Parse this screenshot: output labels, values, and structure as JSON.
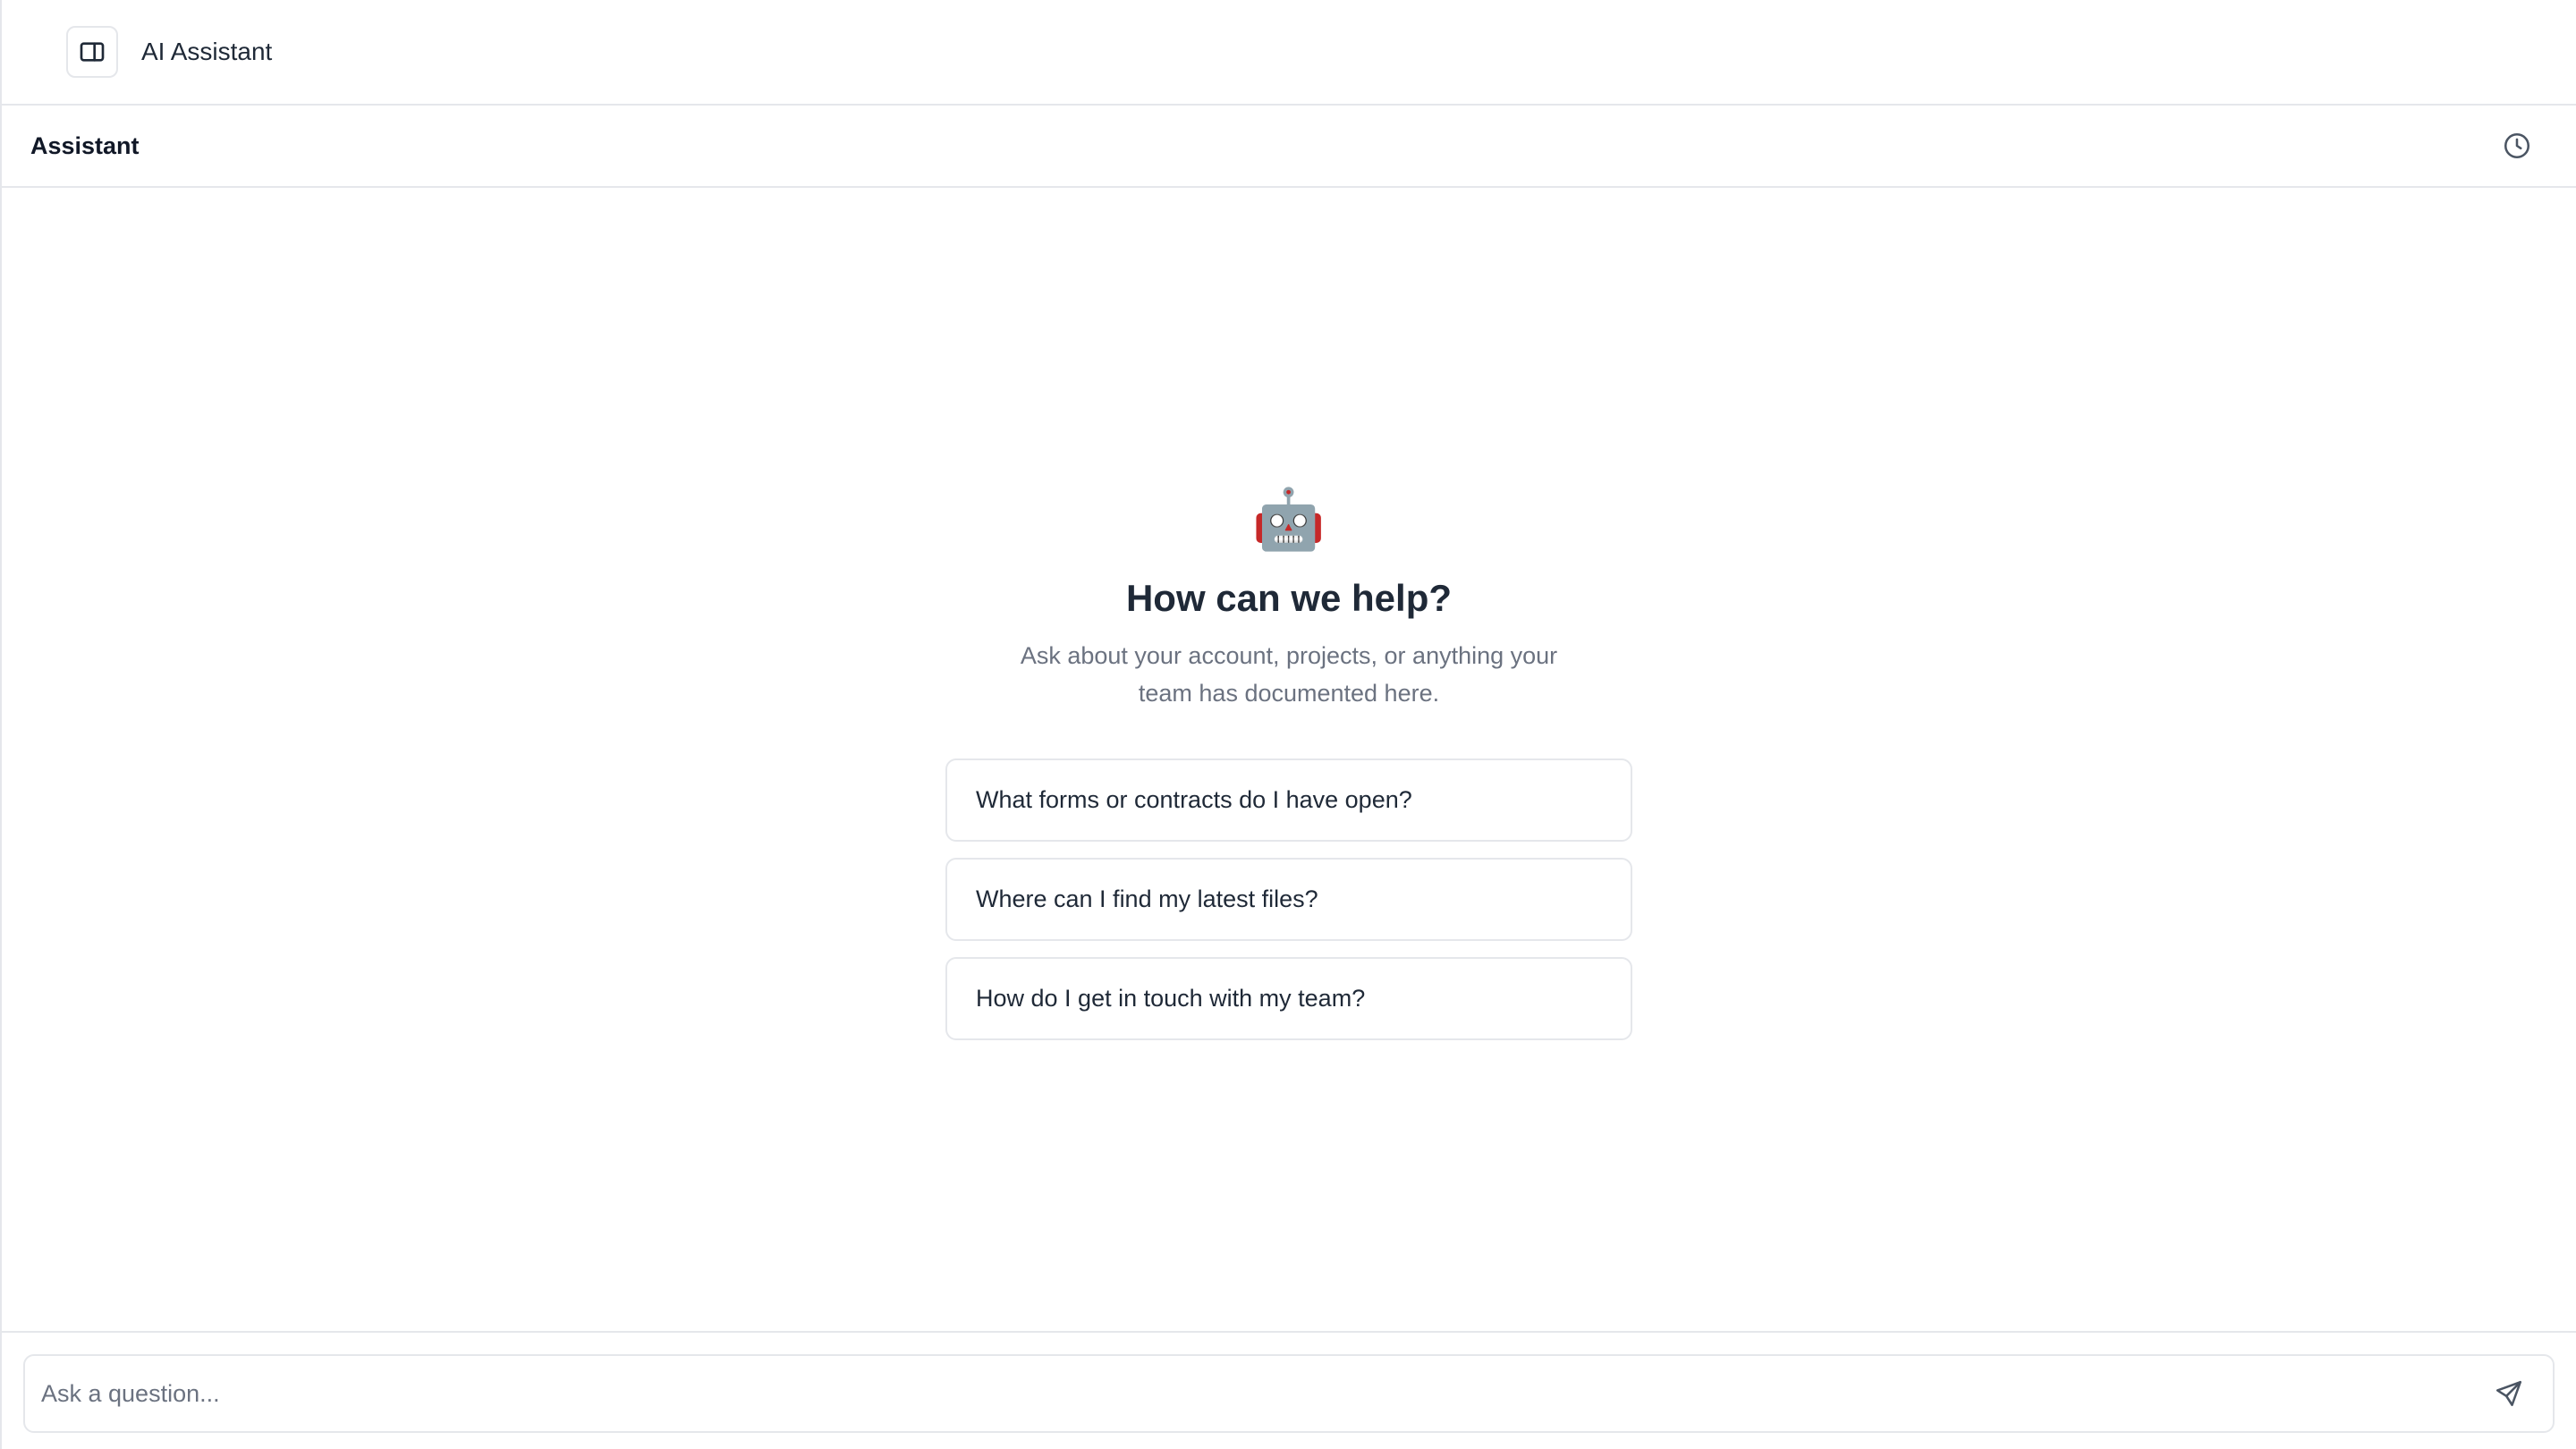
{
  "topbar": {
    "toggle_icon": "sidebar-panel-icon",
    "title": "AI Assistant"
  },
  "panel": {
    "title": "Assistant",
    "history_icon": "clock-icon"
  },
  "empty_state": {
    "icon": "🤖",
    "headline": "How can we help?",
    "subtext": "Ask about your account, projects, or anything your team has documented here.",
    "suggestions": [
      "What forms or contracts do I have open?",
      "Where can I find my latest files?",
      "How do I get in touch with my team?"
    ]
  },
  "composer": {
    "placeholder": "Ask a question...",
    "value": "",
    "send_icon": "send-icon"
  },
  "colors": {
    "border": "#e5e7eb",
    "text": "#1f2937",
    "muted": "#6b7280",
    "background": "#ffffff"
  }
}
